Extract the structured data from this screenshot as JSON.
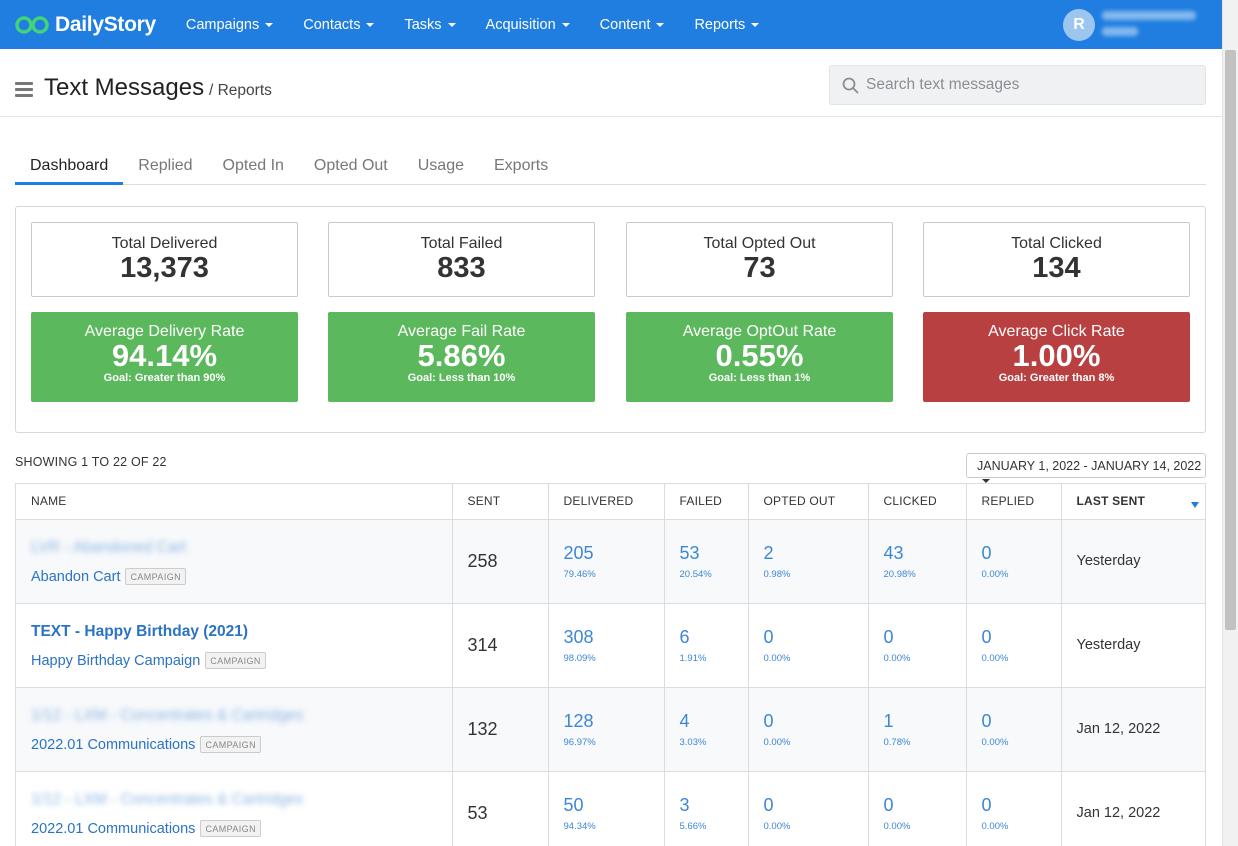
{
  "nav": {
    "brand": "DailyStory",
    "items": [
      {
        "label": "Campaigns"
      },
      {
        "label": "Contacts"
      },
      {
        "label": "Tasks"
      },
      {
        "label": "Acquisition"
      },
      {
        "label": "Content"
      },
      {
        "label": "Reports"
      }
    ],
    "avatar_initial": "R"
  },
  "header": {
    "title": "Text Messages",
    "breadcrumb": "/ Reports",
    "search_placeholder": "Search text messages"
  },
  "tabs": [
    {
      "label": "Dashboard",
      "active": true
    },
    {
      "label": "Replied"
    },
    {
      "label": "Opted In"
    },
    {
      "label": "Opted Out"
    },
    {
      "label": "Usage"
    },
    {
      "label": "Exports"
    }
  ],
  "totals": [
    {
      "label": "Total Delivered",
      "value": "13,373"
    },
    {
      "label": "Total Failed",
      "value": "833"
    },
    {
      "label": "Total Opted Out",
      "value": "73"
    },
    {
      "label": "Total Clicked",
      "value": "134"
    }
  ],
  "rates": [
    {
      "label": "Average Delivery Rate",
      "value": "94.14%",
      "goal": "Goal: Greater than 90%",
      "color": "#5cb85c"
    },
    {
      "label": "Average Fail Rate",
      "value": "5.86%",
      "goal": "Goal: Less than 10%",
      "color": "#5cb85c"
    },
    {
      "label": "Average OptOut Rate",
      "value": "0.55%",
      "goal": "Goal: Less than 1%",
      "color": "#5cb85c"
    },
    {
      "label": "Average Click Rate",
      "value": "1.00%",
      "goal": "Goal: Greater than 8%",
      "color": "#b94040"
    }
  ],
  "listing": {
    "showing": "SHOWING 1 TO 22 OF 22",
    "date_range": "JANUARY 1, 2022 - JANUARY 14, 2022"
  },
  "table": {
    "headers": [
      "NAME",
      "SENT",
      "DELIVERED",
      "FAILED",
      "OPTED OUT",
      "CLICKED",
      "REPLIED",
      "LAST SENT"
    ],
    "rows": [
      {
        "name": "LVR - Abandoned Cart",
        "campaign": "Abandon Cart",
        "badge": "CAMPAIGN",
        "sent": "258",
        "delivered": "205",
        "delivered_pct": "79.46%",
        "failed": "53",
        "failed_pct": "20.54%",
        "opted_out": "2",
        "opted_out_pct": "0.98%",
        "clicked": "43",
        "clicked_pct": "20.98%",
        "replied": "0",
        "replied_pct": "0.00%",
        "last_sent": "Yesterday"
      },
      {
        "name": "TEXT - Happy Birthday (2021)",
        "campaign": "Happy Birthday Campaign",
        "badge": "CAMPAIGN",
        "sent": "314",
        "delivered": "308",
        "delivered_pct": "98.09%",
        "failed": "6",
        "failed_pct": "1.91%",
        "opted_out": "0",
        "opted_out_pct": "0.00%",
        "clicked": "0",
        "clicked_pct": "0.00%",
        "replied": "0",
        "replied_pct": "0.00%",
        "last_sent": "Yesterday"
      },
      {
        "name": "1/12 - LXM - Concentrates & Cartridges",
        "campaign": "2022.01 Communications",
        "badge": "CAMPAIGN",
        "sent": "132",
        "delivered": "128",
        "delivered_pct": "96.97%",
        "failed": "4",
        "failed_pct": "3.03%",
        "opted_out": "0",
        "opted_out_pct": "0.00%",
        "clicked": "1",
        "clicked_pct": "0.78%",
        "replied": "0",
        "replied_pct": "0.00%",
        "last_sent": "Jan 12, 2022"
      },
      {
        "name": "1/12 - LXM - Concentrates & Cartridges",
        "campaign": "2022.01 Communications",
        "badge": "CAMPAIGN",
        "sent": "53",
        "delivered": "50",
        "delivered_pct": "94.34%",
        "failed": "3",
        "failed_pct": "5.66%",
        "opted_out": "0",
        "opted_out_pct": "0.00%",
        "clicked": "0",
        "clicked_pct": "0.00%",
        "replied": "0",
        "replied_pct": "0.00%",
        "last_sent": "Jan 12, 2022"
      }
    ]
  }
}
